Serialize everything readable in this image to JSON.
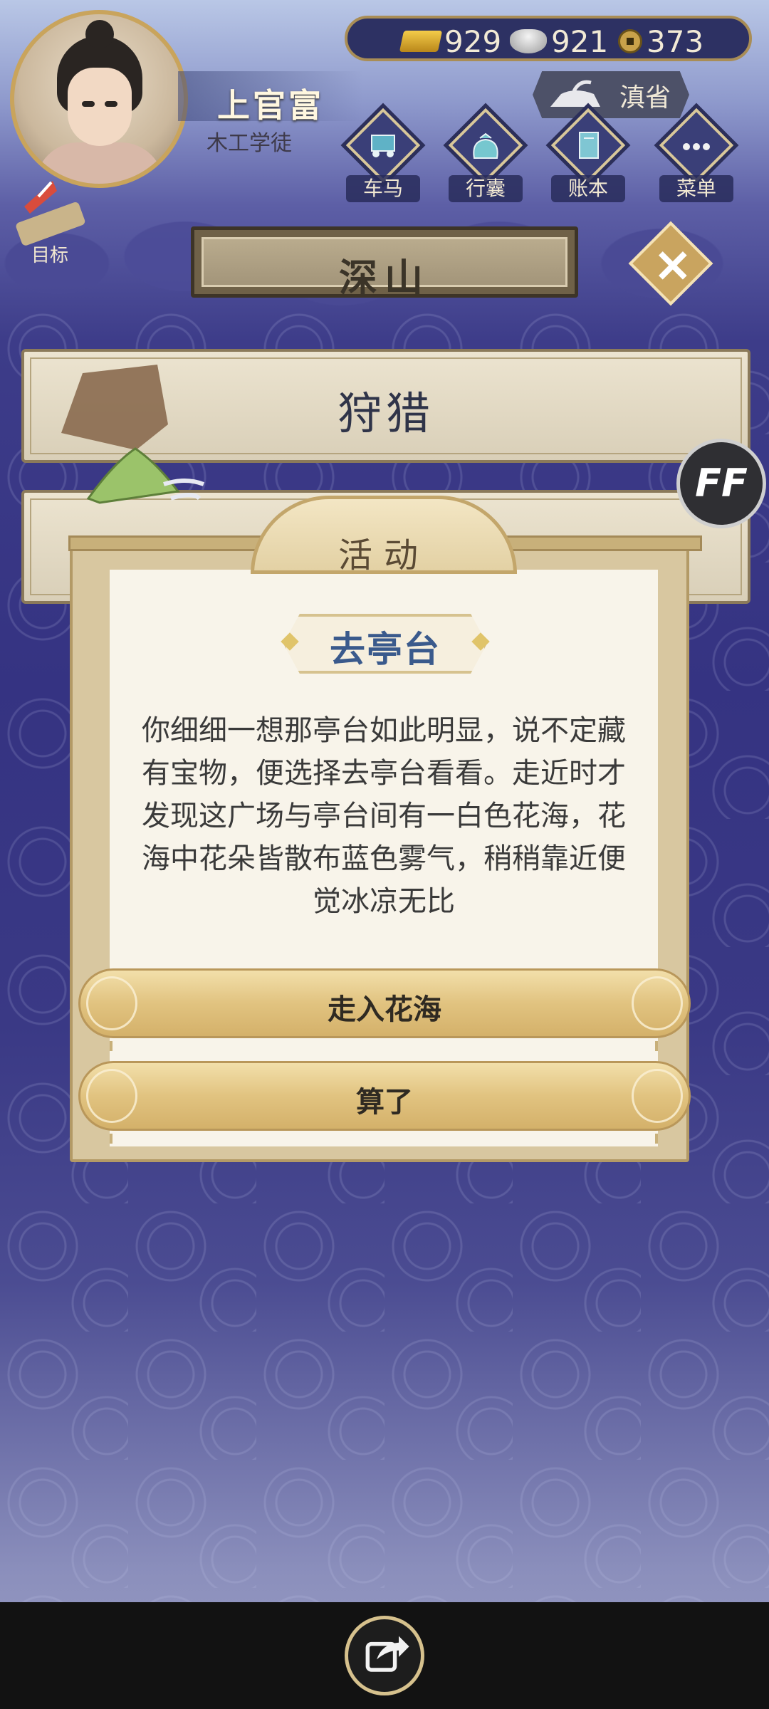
{
  "header": {
    "player_name": "上官富",
    "player_title": "木工学徒",
    "currency": {
      "gold": "929",
      "silver": "921",
      "coin": "373"
    },
    "province": "滇省",
    "menu": [
      {
        "label": "车马",
        "icon": "carriage-icon"
      },
      {
        "label": "行囊",
        "icon": "bag-icon"
      },
      {
        "label": "账本",
        "icon": "ledger-icon"
      },
      {
        "label": "菜单",
        "icon": "more-icon"
      }
    ],
    "goal_label": "目标"
  },
  "location": {
    "name": "深山"
  },
  "activities": [
    {
      "label": "狩猎"
    },
    {
      "label": ""
    }
  ],
  "speed_button": "FF",
  "dialog": {
    "tab_label": "活动",
    "event_title": "去亭台",
    "event_text": "你细细一想那亭台如此明显，说不定藏有宝物，便选择去亭台看看。走近时才发现这广场与亭台间有一白色花海，花海中花朵皆散布蓝色雾气，稍稍靠近便觉冰凉无比",
    "choices": [
      {
        "label": "走入花海"
      },
      {
        "label": "算了"
      }
    ]
  },
  "colors": {
    "accent_gold": "#c9a45c",
    "panel_cream": "#f8f4ea",
    "title_blue": "#3a5a8c",
    "background_indigo": "#353382"
  }
}
